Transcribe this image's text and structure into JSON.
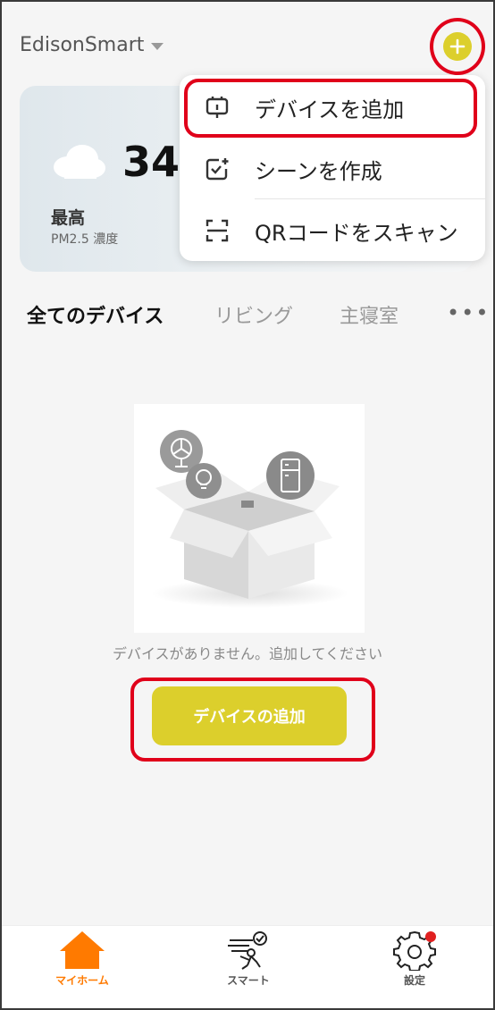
{
  "header": {
    "home_name": "EdisonSmart",
    "add_icon": "plus-circle-icon",
    "accent_color": "#dccf2c"
  },
  "weather": {
    "temperature": "34°",
    "max_label": "最高",
    "pm_label": "PM2.5 濃度",
    "icon": "cloud-icon"
  },
  "menu": {
    "items": [
      {
        "label": "デバイスを追加",
        "icon": "device-add-icon"
      },
      {
        "label": "シーンを作成",
        "icon": "scene-create-icon"
      },
      {
        "label": "QRコードをスキャン",
        "icon": "scan-icon"
      }
    ]
  },
  "tabs": {
    "items": [
      {
        "label": "全てのデバイス",
        "active": true
      },
      {
        "label": "リビング",
        "active": false
      },
      {
        "label": "主寝室",
        "active": false
      }
    ],
    "more_label": "•••"
  },
  "empty_state": {
    "message": "デバイスがありません。追加してください",
    "button_label": "デバイスの追加"
  },
  "bottom_nav": {
    "items": [
      {
        "label": "マイホーム",
        "icon": "home-icon",
        "active": true
      },
      {
        "label": "スマート",
        "icon": "smart-icon",
        "active": false
      },
      {
        "label": "設定",
        "icon": "settings-icon",
        "active": false
      }
    ],
    "active_color": "#ff7a00",
    "badge_color": "#e02020"
  }
}
